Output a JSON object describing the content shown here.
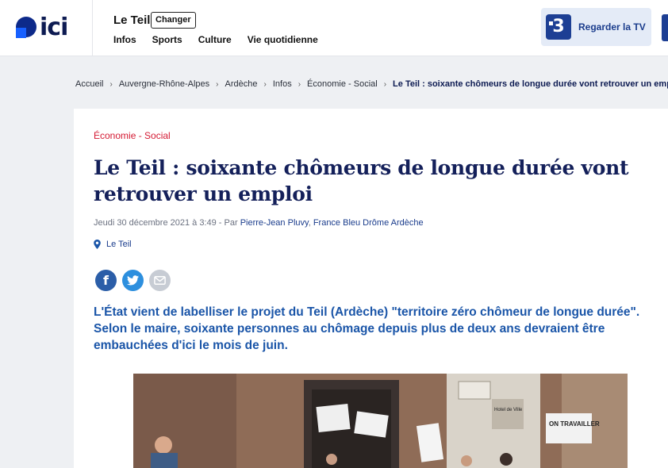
{
  "header": {
    "logo_text": "ici",
    "city": "Le Teil",
    "change_label": "Changer",
    "nav": [
      "Infos",
      "Sports",
      "Culture",
      "Vie quotidienne"
    ],
    "tv_label": "Regarder la TV",
    "tv_logo_text": "3"
  },
  "breadcrumb": {
    "items": [
      "Accueil",
      "Auvergne-Rhône-Alpes",
      "Ardèche",
      "Infos",
      "Économie - Social"
    ],
    "current": "Le Teil : soixante chômeurs de longue durée vont retrouver un emploi"
  },
  "article": {
    "category": "Économie - Social",
    "title": "Le Teil : soixante chômeurs de longue durée vont retrouver un emploi",
    "date_prefix": "Jeudi 30 décembre 2021 à 3:49 - Par ",
    "author": "Pierre-Jean Pluvy",
    "station": "France Bleu Drôme Ardèche",
    "location": "Le Teil",
    "chapo": "L'État vient de labelliser le projet du Teil (Ardèche) \"territoire zéro chômeur de longue durée\". Selon le maire, soixante personnes au chômage depuis plus de deux ans devraient être embauchées d'ici le mois de juin.",
    "photo_signs": [
      "Hotel de Ville",
      "ON TRAVAILLER"
    ]
  },
  "share": [
    "facebook-icon",
    "twitter-icon",
    "mail-icon"
  ],
  "colors": {
    "brand_dark": "#0d1b52",
    "brand_blue": "#1760ff",
    "title": "#14205a",
    "category": "#d41a33",
    "chapo": "#1a55a8",
    "page_bg": "#eef0f3"
  }
}
